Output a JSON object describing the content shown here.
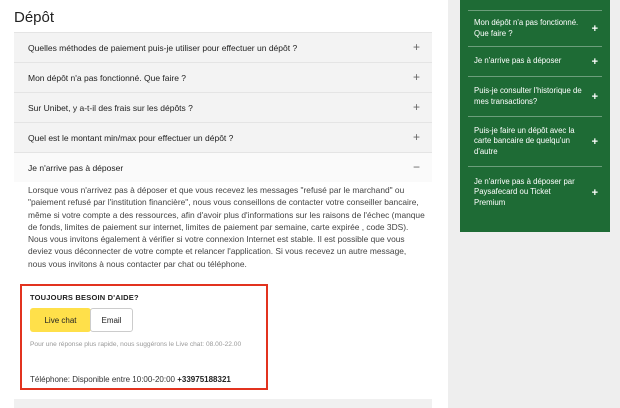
{
  "section_title": "Dépôt",
  "faqs": [
    {
      "question": "Quelles méthodes de paiement puis-je utiliser pour effectuer un dépôt ?",
      "icon": "+"
    },
    {
      "question": "Mon dépôt n'a pas fonctionné. Que faire ?",
      "icon": "+"
    },
    {
      "question": "Sur Unibet, y a-t-il des frais sur les dépôts ?",
      "icon": "+"
    },
    {
      "question": "Quel est le montant min/max pour effectuer un dépôt ?",
      "icon": "+"
    },
    {
      "question": "Je n'arrive pas à déposer",
      "icon": "−"
    }
  ],
  "answer": "Lorsque vous n'arrivez pas à déposer et que vous recevez les messages \"refusé par le marchand\" ou \"paiement refusé par l'institution financière\", nous vous conseillons de contacter votre conseiller bancaire, même si votre compte a des ressources, afin d'avoir plus d'informations sur les raisons de l'échec (manque de fonds, limites de paiement sur internet, limites de paiement par semaine, carte expirée , code 3DS). Nous vous invitons également à vérifier si votre connexion Internet est stable. Il est possible que vous deviez vous déconnecter de votre compte et relancer l'application. Si vous recevez un autre message, nous vous invitons à nous contacter par chat ou téléphone.",
  "help": {
    "title": "TOUJOURS BESOIN D'AIDE?",
    "live_chat": "Live chat",
    "email": "Email",
    "hint": "Pour une réponse plus rapide, nous suggérons le Live chat: 08.00-22.00",
    "phone_label": "Téléphone: Disponible entre 10:00-20:00",
    "phone_number": "+33975188321"
  },
  "sidebar": {
    "items": [
      {
        "label": "Mon dépôt n'a pas fonctionné. Que faire ?",
        "icon": "+"
      },
      {
        "label": "Je n'arrive pas à déposer",
        "icon": "+"
      },
      {
        "label": "Puis-je consulter l'historique de mes transactions?",
        "icon": "+"
      },
      {
        "label": "Puis-je faire un dépôt avec la carte bancaire de quelqu'un d'autre",
        "icon": "+"
      },
      {
        "label": "Je n'arrive pas à déposer par Paysafecard ou Ticket Premium",
        "icon": "+"
      }
    ]
  },
  "colors": {
    "sidebar_bg": "#1e6b35",
    "live_chat_bg": "#ffe04a",
    "highlight_border": "#e2331f"
  }
}
